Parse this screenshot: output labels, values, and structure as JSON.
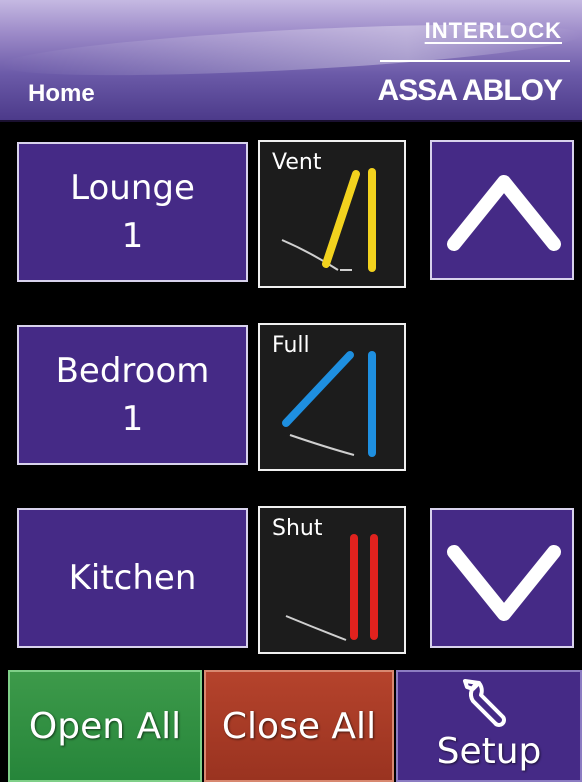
{
  "header": {
    "home_label": "Home",
    "brand_top": "INTERLOCK",
    "brand_bottom": "ASSA ABLOY"
  },
  "rooms": [
    {
      "name": "Lounge",
      "number": "1",
      "status": "Vent",
      "color": "#f2d21e"
    },
    {
      "name": "Bedroom",
      "number": "1",
      "status": "Full",
      "color": "#1e8fe0"
    },
    {
      "name": "Kitchen",
      "number": "",
      "status": "Shut",
      "color": "#e0221e"
    }
  ],
  "nav": {
    "up_icon": "chevron-up-icon",
    "down_icon": "chevron-down-icon"
  },
  "bottom": {
    "open_all": "Open All",
    "close_all": "Close All",
    "setup": "Setup",
    "setup_icon": "wrench-icon"
  },
  "colors": {
    "button_purple": "#452a86",
    "open_green": "#26853a",
    "close_red": "#9a3320"
  }
}
